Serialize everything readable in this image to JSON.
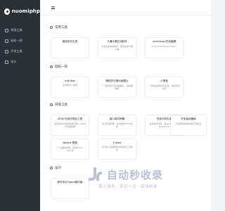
{
  "app": {
    "logo_text": "nuomiphp"
  },
  "sidebar": {
    "items": [
      {
        "label": "常用工具"
      },
      {
        "label": "轻松一刻"
      },
      {
        "label": "开发工具"
      },
      {
        "label": "设计"
      }
    ]
  },
  "sections": [
    {
      "title": "常用工具",
      "cards": [
        {
          "title": "微信防封生成",
          "desc": ""
        },
        {
          "title": "卡通头像在线制作",
          "desc": "卡通头像在线制作，随机生成卡通头像"
        },
        {
          "title": "markdown在线编辑",
          "desc": "Online Markdown Editor"
        }
      ]
    },
    {
      "title": "轻松一刻",
      "cards": [
        {
          "title": "mikutap",
          "desc": "初音音乐小游戏"
        },
        {
          "title": "随机的可爱动画图片",
          "desc": "一个随机的可爱动画图片，放松眼睛吧"
        },
        {
          "title": "小黑盒",
          "desc": "一款精品游戏资讯社区，看完就去玩吧"
        }
      ]
    },
    {
      "title": "开发工具",
      "cards": [
        {
          "title": "JSON 在线可视化工具",
          "desc": "在线将JSON转成树形结构，JSON代码编辑器"
        },
        {
          "title": "接口调试神器",
          "desc": "接口调试利器，在线发送HTTP请求"
        },
        {
          "title": "在线代码生成",
          "desc": "在线生成代码，将JavaScript转TypeScript"
        },
        {
          "title": "开发者武器库",
          "desc": "开发者常用的在线工具集合"
        },
        {
          "title": "Nodejs 镜像",
          "desc": "一个全面的镜像，包括Node、npm等"
        },
        {
          "title": "t-tools",
          "desc": "为开发人员提供的常用在线工具集合"
        }
      ]
    },
    {
      "title": "设计",
      "cards": [
        {
          "title": "即时设计Figma国内版",
          "desc": ""
        }
      ]
    }
  ],
  "watermark": {
    "main": "自动秒收录",
    "sub": "数上排名 · 来访一次 · 自动收录"
  }
}
